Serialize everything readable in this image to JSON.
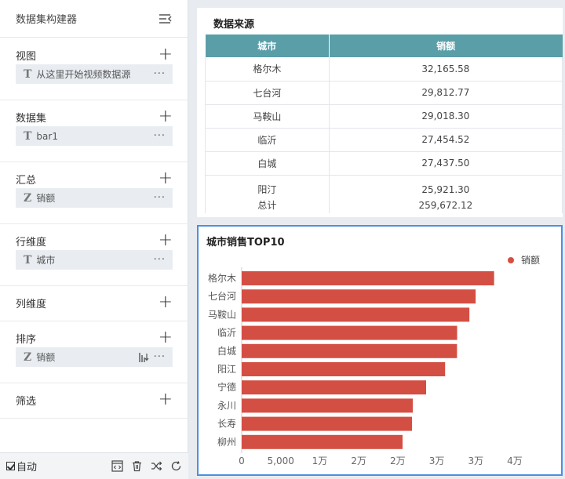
{
  "panel": {
    "title": "数据集构建器",
    "sections": {
      "view": {
        "title": "视图",
        "field": {
          "type": "T",
          "name": "从这里开始视频数据源"
        }
      },
      "dataset": {
        "title": "数据集",
        "field": {
          "type": "T",
          "name": "bar1"
        }
      },
      "summary": {
        "title": "汇总",
        "field": {
          "type": "Z",
          "name": "销额"
        }
      },
      "row_dim": {
        "title": "行维度",
        "field": {
          "type": "T",
          "name": "城市"
        }
      },
      "col_dim": {
        "title": "列维度"
      },
      "sort": {
        "title": "排序",
        "field": {
          "type": "Z",
          "name": "销额"
        }
      },
      "filter": {
        "title": "筛选"
      }
    },
    "auto_label": "自动",
    "icons": [
      "code-icon",
      "trash-icon",
      "shuffle-icon",
      "refresh-icon"
    ]
  },
  "table": {
    "title": "数据来源",
    "headers": [
      "城市",
      "销额"
    ],
    "rows": [
      [
        "格尔木",
        "32,165.58"
      ],
      [
        "七台河",
        "29,812.77"
      ],
      [
        "马鞍山",
        "29,018.30"
      ],
      [
        "临沂",
        "27,454.52"
      ],
      [
        "白城",
        "27,437.50"
      ]
    ],
    "last_row": [
      "阳汀",
      "25,921.30"
    ],
    "total": {
      "label": "总计",
      "value": "259,672.12"
    }
  },
  "chart": {
    "title": "城市销售TOP10",
    "legend": "销额"
  },
  "chart_data": {
    "type": "bar",
    "orientation": "horizontal",
    "title": "城市销售TOP10",
    "categories": [
      "格尔木",
      "七台河",
      "马鞍山",
      "临沂",
      "白城",
      "阳江",
      "宁德",
      "永川",
      "长寿",
      "柳州"
    ],
    "series": [
      {
        "name": "销额",
        "values": [
          32165.58,
          29812.77,
          29018.3,
          27454.52,
          27437.5,
          25921.3,
          23500,
          21800,
          21700,
          20500
        ]
      }
    ],
    "xlim": [
      0,
      35000
    ],
    "x_ticks": [
      "0",
      "5,000",
      "1万",
      "2万",
      "2万",
      "3万",
      "3万",
      "4万"
    ],
    "color": "#d44f43",
    "legend_position": "top-right"
  },
  "colors": {
    "header_teal": "#5a9ea8",
    "bar_red": "#d44f43",
    "selection_blue": "#4a90e2"
  }
}
